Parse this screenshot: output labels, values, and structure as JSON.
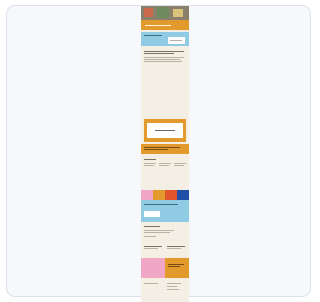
{
  "page": {
    "header_title": "",
    "promo_heading": "",
    "article_title": "",
    "modal_text": "",
    "cta_label": "",
    "info_heading": "",
    "footer_text": ""
  },
  "colors": {
    "background": "#f3efe4",
    "orange": "#e39a2d",
    "blue": "#8fcbe3",
    "pink": "#f2a6c6",
    "red": "#e0552b",
    "dark_blue": "#1f4fa8",
    "white": "#ffffff"
  },
  "swatches": [
    "#f2a6c6",
    "#e39a2d",
    "#e0552b",
    "#1f4fa8"
  ]
}
